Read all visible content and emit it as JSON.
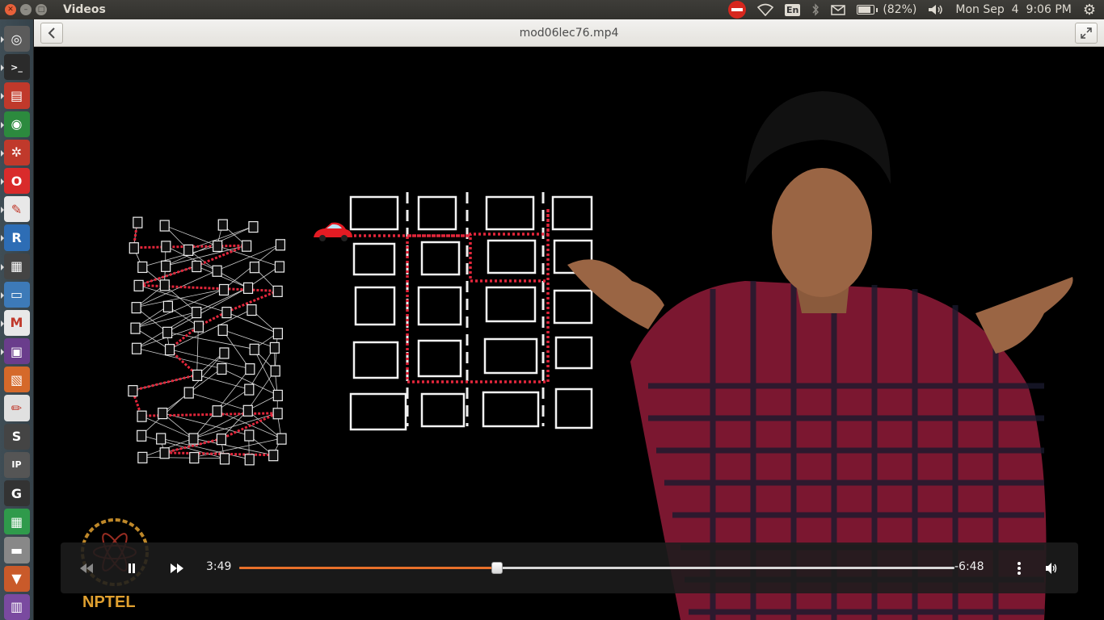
{
  "top_panel": {
    "app_title": "Videos",
    "lang": "En",
    "battery_text": "(82%)",
    "battery_level": 0.82,
    "clock": "Mon Sep  4  9:06 PM"
  },
  "header": {
    "filename": "mod06lec76.mp4"
  },
  "video": {
    "watermark": "NPTEL"
  },
  "player": {
    "elapsed": "3:49",
    "remaining": "-6:48",
    "progress": 0.36,
    "accent": "#e8702a"
  },
  "launcher": {
    "items": [
      {
        "name": "dash-icon",
        "color": "#5b5b5b",
        "glyph": "◎"
      },
      {
        "name": "terminal-icon",
        "color": "#2b2b2b",
        "glyph": ">_"
      },
      {
        "name": "files-icon",
        "color": "#c0392b",
        "glyph": "▤"
      },
      {
        "name": "chrome-icon",
        "color": "#2c8a3e",
        "glyph": "◉"
      },
      {
        "name": "settings-icon",
        "color": "#c0392b",
        "glyph": "✲"
      },
      {
        "name": "opera-icon",
        "color": "#d92b2b",
        "glyph": "O"
      },
      {
        "name": "document-viewer-icon",
        "color": "#e8e8e8",
        "glyph": "✎"
      },
      {
        "name": "r-icon",
        "color": "#2d6db5",
        "glyph": "R"
      },
      {
        "name": "video-editor-icon",
        "color": "#444",
        "glyph": "▦"
      },
      {
        "name": "writer-icon",
        "color": "#3d7ab8",
        "glyph": "▭"
      },
      {
        "name": "gmail-icon",
        "color": "#e8e8e8",
        "glyph": "M"
      },
      {
        "name": "media-icon",
        "color": "#6a3d8c",
        "glyph": "▣"
      },
      {
        "name": "impress-icon",
        "color": "#d5692a",
        "glyph": "▧"
      },
      {
        "name": "text-editor-icon",
        "color": "#e0e0e0",
        "glyph": "✏"
      },
      {
        "name": "sublime-icon",
        "color": "#444",
        "glyph": "S"
      },
      {
        "name": "ipython-icon",
        "color": "#555",
        "glyph": "IP"
      },
      {
        "name": "gp-icon",
        "color": "#333",
        "glyph": "G"
      },
      {
        "name": "calc-icon",
        "color": "#2f9a4b",
        "glyph": "▦"
      },
      {
        "name": "drive-icon",
        "color": "#888",
        "glyph": "▬"
      },
      {
        "name": "install-icon",
        "color": "#c95a2a",
        "glyph": "▼"
      },
      {
        "name": "trash-icon",
        "color": "#7a4aa0",
        "glyph": "▥"
      }
    ]
  }
}
